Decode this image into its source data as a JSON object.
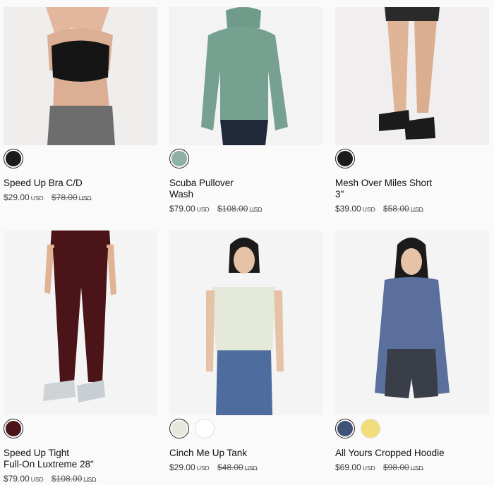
{
  "products": [
    {
      "name": "Speed Up Bra C/D",
      "price": "$29.00",
      "currency": "USD",
      "compare_price": "$78.00",
      "compare_currency": "USD",
      "swatches": [
        "#1c1c1c"
      ]
    },
    {
      "name": "Scuba Pullover\nWash",
      "price": "$79.00",
      "currency": "USD",
      "compare_price": "$108.00",
      "compare_currency": "USD",
      "swatches": [
        "#8fb0a6"
      ]
    },
    {
      "name": "Mesh Over Miles Short\n3\"",
      "price": "$39.00",
      "currency": "USD",
      "compare_price": "$58.00",
      "compare_currency": "USD",
      "swatches": [
        "#1c1c1c"
      ]
    },
    {
      "name": "Speed Up Tight\nFull-On Luxtreme 28\"",
      "price": "$79.00",
      "currency": "USD",
      "compare_price": "$108.00",
      "compare_currency": "USD",
      "swatches": [
        "#4a1418"
      ]
    },
    {
      "name": "Cinch Me Up Tank",
      "price": "$29.00",
      "currency": "USD",
      "compare_price": "$48.00",
      "compare_currency": "USD",
      "swatches": [
        "#e6e8dc",
        "#ffffff"
      ]
    },
    {
      "name": "All Yours Cropped Hoodie",
      "price": "$69.00",
      "currency": "USD",
      "compare_price": "$98.00",
      "compare_currency": "USD",
      "swatches": [
        "#3e5377",
        "#f2dd7a"
      ]
    }
  ]
}
